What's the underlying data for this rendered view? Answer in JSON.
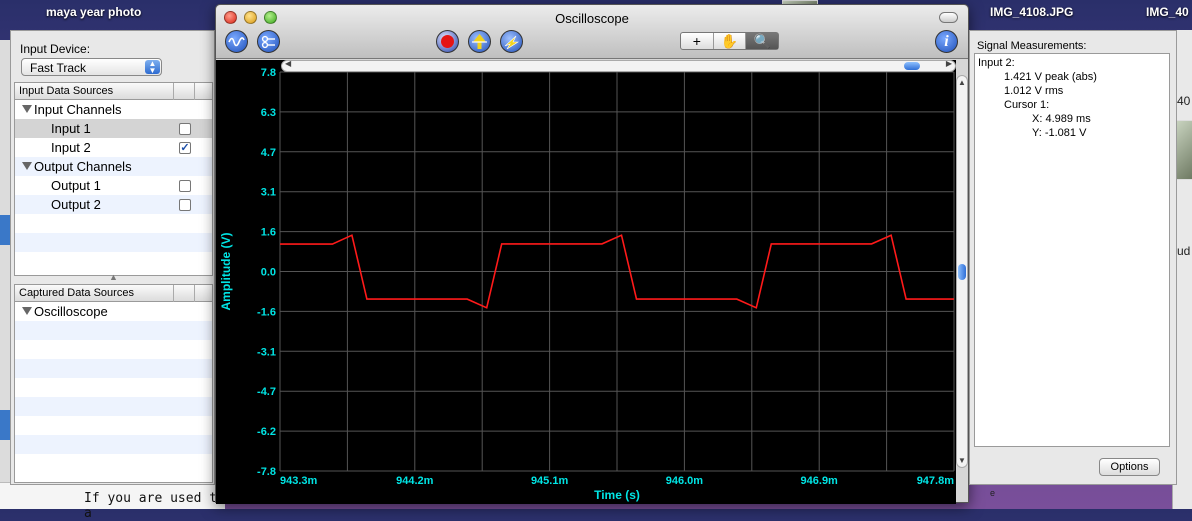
{
  "desktop": {
    "labels": [
      "maya year photo",
      "IMG_4108.JPG",
      "IMG_40"
    ],
    "partial_texts": [
      "40",
      "ud",
      "e",
      "If you are used to a"
    ]
  },
  "drawer": {
    "input_device_label": "Input Device:",
    "input_device_value": "Fast Track",
    "input_sources_header": "Input Data Sources",
    "input_sources": [
      {
        "label": "Input Channels",
        "kind": "group"
      },
      {
        "label": "Input 1",
        "kind": "item",
        "checked": false
      },
      {
        "label": "Input 2",
        "kind": "item",
        "checked": true
      },
      {
        "label": "Output Channels",
        "kind": "group"
      },
      {
        "label": "Output 1",
        "kind": "item",
        "checked": false
      },
      {
        "label": "Output 2",
        "kind": "item",
        "checked": false
      }
    ],
    "captured_header": "Captured Data Sources",
    "captured_sources": [
      {
        "label": "Oscilloscope",
        "kind": "group"
      }
    ]
  },
  "window": {
    "title": "Oscilloscope",
    "toolbar": {
      "signal_icon": "waveform-icon",
      "settings_icon": "settings-icon",
      "record_icon": "record-icon",
      "trigger_icon": "trigger-icon",
      "capture_icon": "capture-icon",
      "tools": [
        "+",
        "✋",
        "🔍"
      ],
      "info_icon": "info-icon",
      "info_label": "i"
    },
    "colors": {
      "trace": "#ff1a1a",
      "axis": "#00e5e5",
      "grid": "#555555",
      "plot_bg": "#000000"
    }
  },
  "chart_data": {
    "type": "line",
    "title": "",
    "xlabel": "Time (s)",
    "ylabel": "Amplitude (V)",
    "xticks": [
      "943.3m",
      "944.2m",
      "945.1m",
      "946.0m",
      "946.9m",
      "947.8m"
    ],
    "yticks": [
      "7.8",
      "6.3",
      "4.7",
      "3.1",
      "1.6",
      "0.0",
      "-1.6",
      "-3.1",
      "-4.7",
      "-6.2",
      "-7.8"
    ],
    "xlim": [
      0.9433,
      0.9478
    ],
    "ylim": [
      -7.8,
      7.8
    ],
    "grid": true,
    "series": [
      {
        "x": [
          0.9433,
          0.94365,
          0.94378,
          0.94388,
          0.9442,
          0.94455,
          0.94468,
          0.94478,
          0.9451,
          0.94545,
          0.94558,
          0.94568,
          0.946,
          0.94635,
          0.94648,
          0.94658,
          0.9469,
          0.94725,
          0.94738,
          0.94748,
          0.9478
        ],
        "y": [
          1.07,
          1.07,
          1.42,
          -1.08,
          -1.08,
          -1.08,
          -1.42,
          1.08,
          1.08,
          1.08,
          1.42,
          -1.08,
          -1.08,
          -1.08,
          -1.42,
          1.08,
          1.08,
          1.08,
          1.42,
          -1.08,
          -1.08
        ],
        "values": [
          1.07,
          1.07,
          1.42,
          -1.08,
          -1.08,
          -1.08,
          -1.42,
          1.08,
          1.08,
          1.08,
          1.42,
          -1.08,
          -1.08,
          -1.08,
          -1.42,
          1.08,
          1.08,
          1.08,
          1.42,
          -1.08,
          -1.08
        ]
      }
    ]
  },
  "measurements": {
    "header": "Signal Measurements:",
    "lines": [
      "Input 2:",
      "1.421 V peak (abs)",
      "1.012 V rms",
      "Cursor 1:",
      "X: 4.989 ms",
      "Y: -1.081 V"
    ],
    "options_label": "Options"
  }
}
